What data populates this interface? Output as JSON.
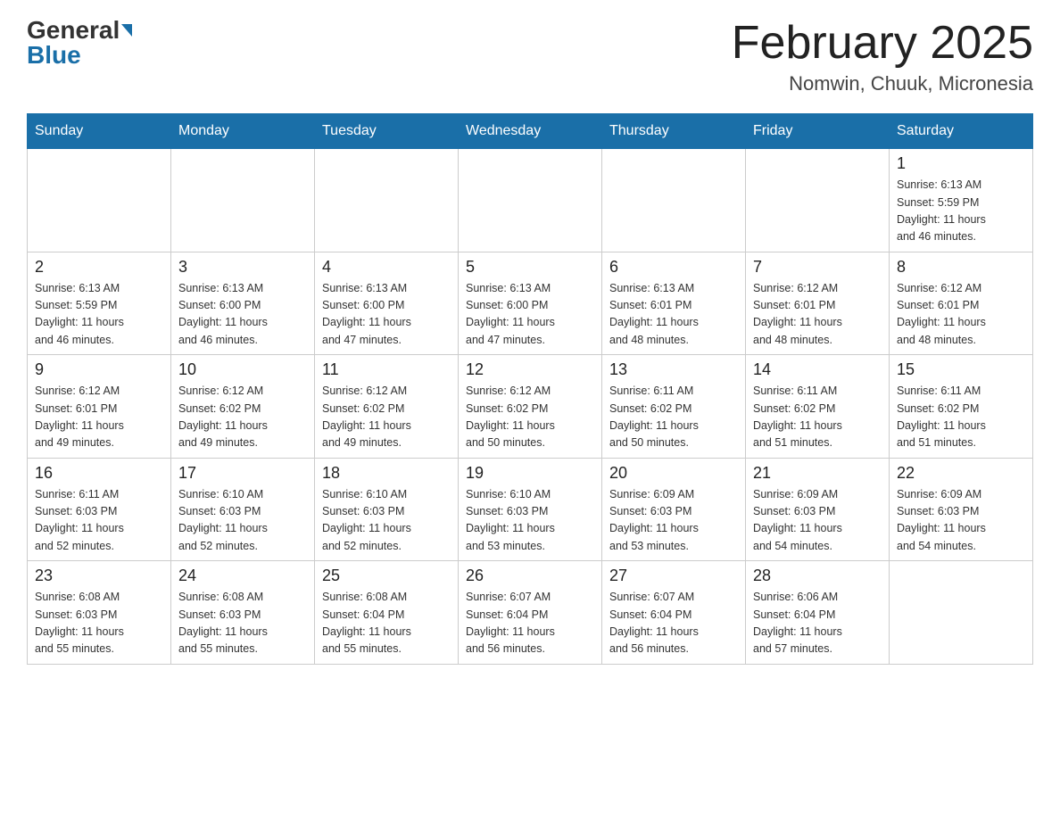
{
  "header": {
    "logo_general": "General",
    "logo_blue": "Blue",
    "month_title": "February 2025",
    "location": "Nomwin, Chuuk, Micronesia"
  },
  "weekdays": [
    "Sunday",
    "Monday",
    "Tuesday",
    "Wednesday",
    "Thursday",
    "Friday",
    "Saturday"
  ],
  "weeks": [
    [
      {
        "day": "",
        "info": ""
      },
      {
        "day": "",
        "info": ""
      },
      {
        "day": "",
        "info": ""
      },
      {
        "day": "",
        "info": ""
      },
      {
        "day": "",
        "info": ""
      },
      {
        "day": "",
        "info": ""
      },
      {
        "day": "1",
        "info": "Sunrise: 6:13 AM\nSunset: 5:59 PM\nDaylight: 11 hours\nand 46 minutes."
      }
    ],
    [
      {
        "day": "2",
        "info": "Sunrise: 6:13 AM\nSunset: 5:59 PM\nDaylight: 11 hours\nand 46 minutes."
      },
      {
        "day": "3",
        "info": "Sunrise: 6:13 AM\nSunset: 6:00 PM\nDaylight: 11 hours\nand 46 minutes."
      },
      {
        "day": "4",
        "info": "Sunrise: 6:13 AM\nSunset: 6:00 PM\nDaylight: 11 hours\nand 47 minutes."
      },
      {
        "day": "5",
        "info": "Sunrise: 6:13 AM\nSunset: 6:00 PM\nDaylight: 11 hours\nand 47 minutes."
      },
      {
        "day": "6",
        "info": "Sunrise: 6:13 AM\nSunset: 6:01 PM\nDaylight: 11 hours\nand 48 minutes."
      },
      {
        "day": "7",
        "info": "Sunrise: 6:12 AM\nSunset: 6:01 PM\nDaylight: 11 hours\nand 48 minutes."
      },
      {
        "day": "8",
        "info": "Sunrise: 6:12 AM\nSunset: 6:01 PM\nDaylight: 11 hours\nand 48 minutes."
      }
    ],
    [
      {
        "day": "9",
        "info": "Sunrise: 6:12 AM\nSunset: 6:01 PM\nDaylight: 11 hours\nand 49 minutes."
      },
      {
        "day": "10",
        "info": "Sunrise: 6:12 AM\nSunset: 6:02 PM\nDaylight: 11 hours\nand 49 minutes."
      },
      {
        "day": "11",
        "info": "Sunrise: 6:12 AM\nSunset: 6:02 PM\nDaylight: 11 hours\nand 49 minutes."
      },
      {
        "day": "12",
        "info": "Sunrise: 6:12 AM\nSunset: 6:02 PM\nDaylight: 11 hours\nand 50 minutes."
      },
      {
        "day": "13",
        "info": "Sunrise: 6:11 AM\nSunset: 6:02 PM\nDaylight: 11 hours\nand 50 minutes."
      },
      {
        "day": "14",
        "info": "Sunrise: 6:11 AM\nSunset: 6:02 PM\nDaylight: 11 hours\nand 51 minutes."
      },
      {
        "day": "15",
        "info": "Sunrise: 6:11 AM\nSunset: 6:02 PM\nDaylight: 11 hours\nand 51 minutes."
      }
    ],
    [
      {
        "day": "16",
        "info": "Sunrise: 6:11 AM\nSunset: 6:03 PM\nDaylight: 11 hours\nand 52 minutes."
      },
      {
        "day": "17",
        "info": "Sunrise: 6:10 AM\nSunset: 6:03 PM\nDaylight: 11 hours\nand 52 minutes."
      },
      {
        "day": "18",
        "info": "Sunrise: 6:10 AM\nSunset: 6:03 PM\nDaylight: 11 hours\nand 52 minutes."
      },
      {
        "day": "19",
        "info": "Sunrise: 6:10 AM\nSunset: 6:03 PM\nDaylight: 11 hours\nand 53 minutes."
      },
      {
        "day": "20",
        "info": "Sunrise: 6:09 AM\nSunset: 6:03 PM\nDaylight: 11 hours\nand 53 minutes."
      },
      {
        "day": "21",
        "info": "Sunrise: 6:09 AM\nSunset: 6:03 PM\nDaylight: 11 hours\nand 54 minutes."
      },
      {
        "day": "22",
        "info": "Sunrise: 6:09 AM\nSunset: 6:03 PM\nDaylight: 11 hours\nand 54 minutes."
      }
    ],
    [
      {
        "day": "23",
        "info": "Sunrise: 6:08 AM\nSunset: 6:03 PM\nDaylight: 11 hours\nand 55 minutes."
      },
      {
        "day": "24",
        "info": "Sunrise: 6:08 AM\nSunset: 6:03 PM\nDaylight: 11 hours\nand 55 minutes."
      },
      {
        "day": "25",
        "info": "Sunrise: 6:08 AM\nSunset: 6:04 PM\nDaylight: 11 hours\nand 55 minutes."
      },
      {
        "day": "26",
        "info": "Sunrise: 6:07 AM\nSunset: 6:04 PM\nDaylight: 11 hours\nand 56 minutes."
      },
      {
        "day": "27",
        "info": "Sunrise: 6:07 AM\nSunset: 6:04 PM\nDaylight: 11 hours\nand 56 minutes."
      },
      {
        "day": "28",
        "info": "Sunrise: 6:06 AM\nSunset: 6:04 PM\nDaylight: 11 hours\nand 57 minutes."
      },
      {
        "day": "",
        "info": ""
      }
    ]
  ]
}
